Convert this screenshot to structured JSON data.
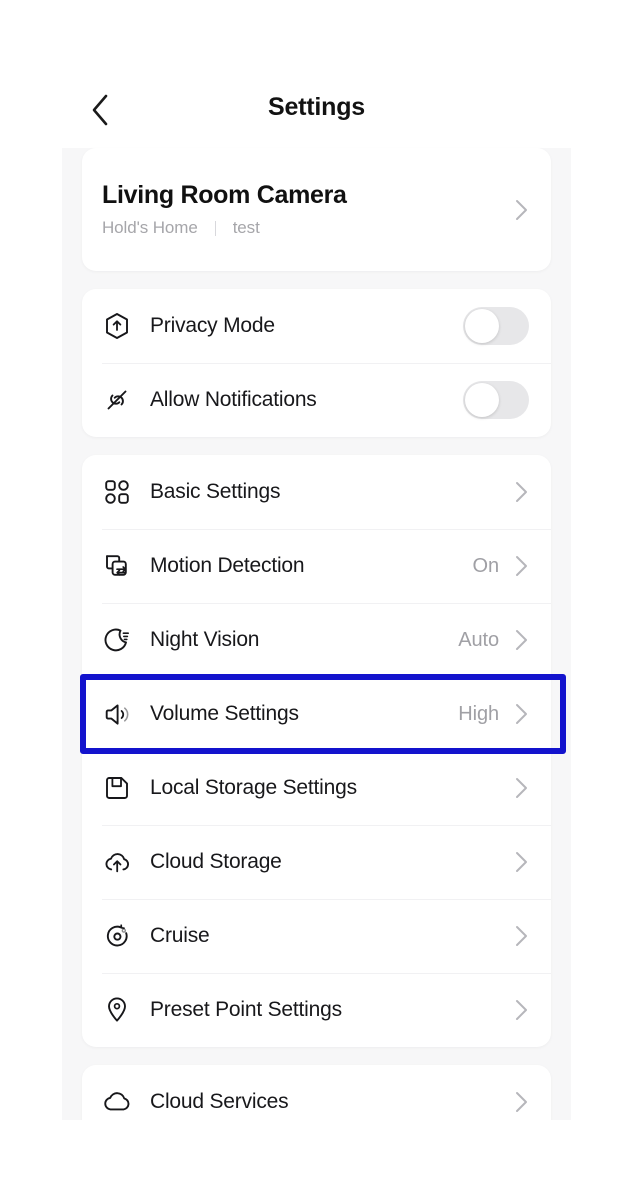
{
  "nav": {
    "back_icon": "chevron-left-icon",
    "title": "Settings"
  },
  "device": {
    "name": "Living Room Camera",
    "home": "Hold's Home",
    "room": "test",
    "chevron": "chevron-right-icon"
  },
  "toggles": [
    {
      "label": "Privacy Mode",
      "icon": "privacy-shield-icon",
      "state": "off"
    },
    {
      "label": "Allow Notifications",
      "icon": "notification-muted-icon",
      "state": "off"
    }
  ],
  "settings_items": [
    {
      "label": "Basic Settings",
      "icon": "grid-apps-icon",
      "value": "",
      "highlighted": false
    },
    {
      "label": "Motion Detection",
      "icon": "motion-detection-icon",
      "value": "On",
      "highlighted": false
    },
    {
      "label": "Night Vision",
      "icon": "moon-icon",
      "value": "Auto",
      "highlighted": false
    },
    {
      "label": "Volume Settings",
      "icon": "speaker-volume-icon",
      "value": "High",
      "highlighted": true
    },
    {
      "label": "Local Storage Settings",
      "icon": "floppy-disk-icon",
      "value": "",
      "highlighted": false
    },
    {
      "label": "Cloud Storage",
      "icon": "cloud-upload-icon",
      "value": "",
      "highlighted": false
    },
    {
      "label": "Cruise",
      "icon": "cruise-rotate-icon",
      "value": "",
      "highlighted": false
    },
    {
      "label": "Preset Point Settings",
      "icon": "location-pin-icon",
      "value": "",
      "highlighted": false
    }
  ],
  "services_items": [
    {
      "label": "Cloud Services",
      "icon": "cloud-icon",
      "value": "",
      "highlighted": false
    }
  ],
  "colors": {
    "highlight": "#1313cd",
    "page_background": "#f7f7f8",
    "card": "#ffffff",
    "text_primary": "#18181b",
    "text_secondary": "#a0a0a5"
  }
}
